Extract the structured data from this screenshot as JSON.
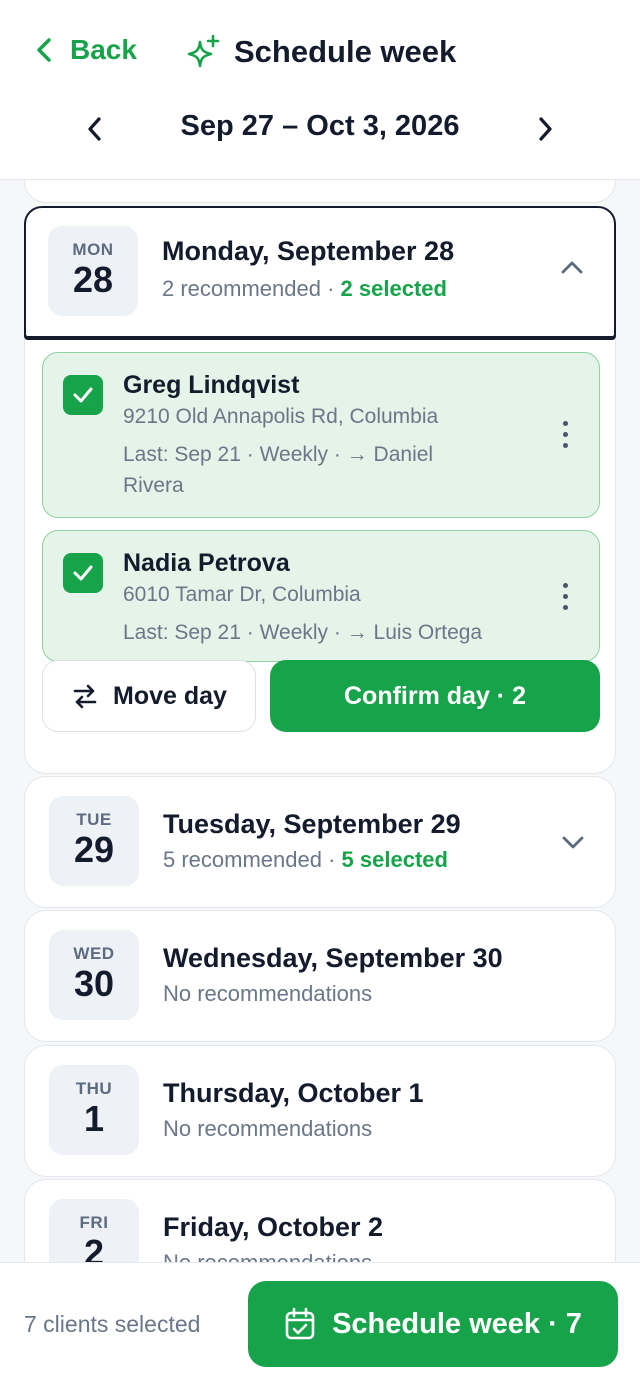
{
  "header": {
    "back_label": "Back",
    "title": "Schedule week",
    "week_range": "Sep 27 – Oct 3, 2026"
  },
  "days": [
    {
      "dow": "MON",
      "num": "28",
      "title": "Monday, September 28",
      "recommended": "2 recommended",
      "sep": " · ",
      "selected": "2 selected",
      "clients": [
        {
          "name": "Greg Lindqvist",
          "address": "9210 Old Annapolis Rd, Columbia",
          "last": "Last: Sep 21 · Weekly · → Daniel Rivera"
        },
        {
          "name": "Nadia Petrova",
          "address": "6010 Tamar Dr, Columbia",
          "last": "Last: Sep 21 · Weekly · → Luis Ortega"
        }
      ],
      "move_label": "Move day",
      "confirm_label": "Confirm day · 2"
    },
    {
      "dow": "TUE",
      "num": "29",
      "title": "Tuesday, September 29",
      "recommended": "5 recommended",
      "sep": " · ",
      "selected": "5 selected"
    },
    {
      "dow": "WED",
      "num": "30",
      "title": "Wednesday, September 30",
      "sub": "No recommendations"
    },
    {
      "dow": "THU",
      "num": "1",
      "title": "Thursday, October 1",
      "sub": "No recommendations"
    },
    {
      "dow": "FRI",
      "num": "2",
      "title": "Friday, October 2",
      "sub": "No recommendations"
    }
  ],
  "footer": {
    "count": "7 clients selected",
    "schedule_label": "Schedule week · 7"
  },
  "colors": {
    "accent": "#17a34a",
    "accent_bg": "#e4f4e8",
    "text": "#141b2d",
    "muted": "#6b7689"
  }
}
